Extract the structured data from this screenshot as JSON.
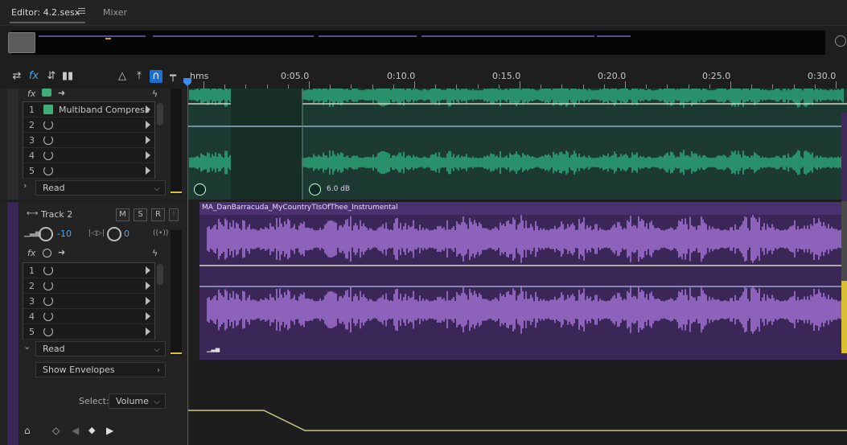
{
  "tabs": {
    "editor": "Editor: 4.2.sesx",
    "mixer": "Mixer"
  },
  "ruler": {
    "labels": [
      "hms",
      "0:05.0",
      "0:10.0",
      "0:15.0",
      "0:20.0",
      "0:25.0",
      "0:30.0"
    ]
  },
  "track1": {
    "effects": [
      {
        "num": "1",
        "name": "Multiband Compress",
        "on": true
      },
      {
        "num": "2",
        "name": ""
      },
      {
        "num": "3",
        "name": ""
      },
      {
        "num": "4",
        "name": ""
      },
      {
        "num": "5",
        "name": ""
      }
    ],
    "mode": "Read",
    "clip_gain": "6.0 dB"
  },
  "track2": {
    "name": "Track 2",
    "mute": "M",
    "solo": "S",
    "record": "R",
    "volume": "-10",
    "pan": "0",
    "effects": [
      {
        "num": "1",
        "name": ""
      },
      {
        "num": "2",
        "name": ""
      },
      {
        "num": "3",
        "name": ""
      },
      {
        "num": "4",
        "name": ""
      },
      {
        "num": "5",
        "name": ""
      }
    ],
    "mode": "Read",
    "show_envelopes": "Show Envelopes",
    "select_label": "Select:",
    "select_value": "Volume",
    "clip_name": "MA_DanBarracuda_MyCountryTIsOfThee_Instrumental"
  },
  "colors": {
    "track1_wave": "#2fb585",
    "track2_wave": "#b07de6",
    "playhead": "#c8362a",
    "accent": "#3b8cf0"
  }
}
